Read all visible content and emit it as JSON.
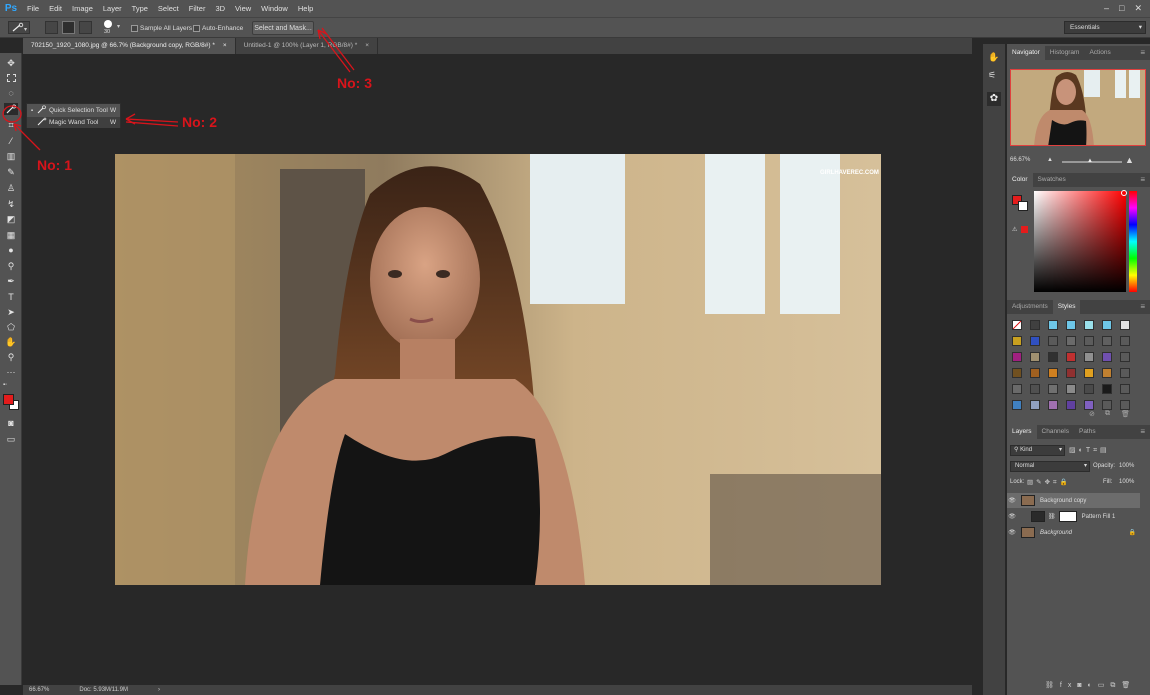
{
  "app": {
    "logo": "Ps"
  },
  "menu": [
    "File",
    "Edit",
    "Image",
    "Layer",
    "Type",
    "Select",
    "Filter",
    "3D",
    "View",
    "Window",
    "Help"
  ],
  "window_controls": [
    "–",
    "□",
    "✕"
  ],
  "options": {
    "brush_size": "30",
    "sample_all_layers": "Sample All Layers",
    "auto_enhance": "Auto-Enhance",
    "select_and_mask": "Select and Mask...",
    "workspace": "Essentials"
  },
  "tabs": [
    {
      "label": "702150_1920_1080.jpg @ 66.7% (Background copy, RGB/8#) *",
      "close": "×"
    },
    {
      "label": "Untitled-1 @ 100% (Layer 1, RGB/8#) *",
      "close": "×"
    }
  ],
  "flyout": {
    "items": [
      {
        "label": "Quick Selection Tool",
        "shortcut": "W"
      },
      {
        "label": "Magic Wand Tool",
        "shortcut": "W"
      }
    ]
  },
  "annotations": {
    "no1": "No: 1",
    "no2": "No: 2",
    "no3": "No: 3"
  },
  "canvas": {
    "watermark": "GIRLHAVEREC.COM"
  },
  "status": {
    "zoom": "66.67%",
    "doc": "Doc: 5.93M/11.9M"
  },
  "navigator": {
    "tabs": [
      "Navigator",
      "Histogram",
      "Actions"
    ],
    "zoom": "66.67%"
  },
  "color_panel": {
    "tabs": [
      "Color",
      "Swatches"
    ],
    "foreground": "#e41c1c",
    "background": "#ffffff"
  },
  "styles_panel": {
    "tabs": [
      "Adjustments",
      "Styles"
    ]
  },
  "layers_panel": {
    "tabs": [
      "Layers",
      "Channels",
      "Paths"
    ],
    "kind": "Kind",
    "blend_mode": "Normal",
    "opacity_label": "Opacity:",
    "opacity": "100%",
    "lock_label": "Lock:",
    "fill_label": "Fill:",
    "fill": "100%",
    "layers": [
      {
        "name": "Background copy",
        "active": true
      },
      {
        "name": "Pattern Fill 1",
        "active": false
      },
      {
        "name": "Background",
        "active": false,
        "italic": true
      }
    ]
  },
  "colors": {
    "accent": "#d8141b",
    "panel": "#535353",
    "dark": "#282828"
  }
}
